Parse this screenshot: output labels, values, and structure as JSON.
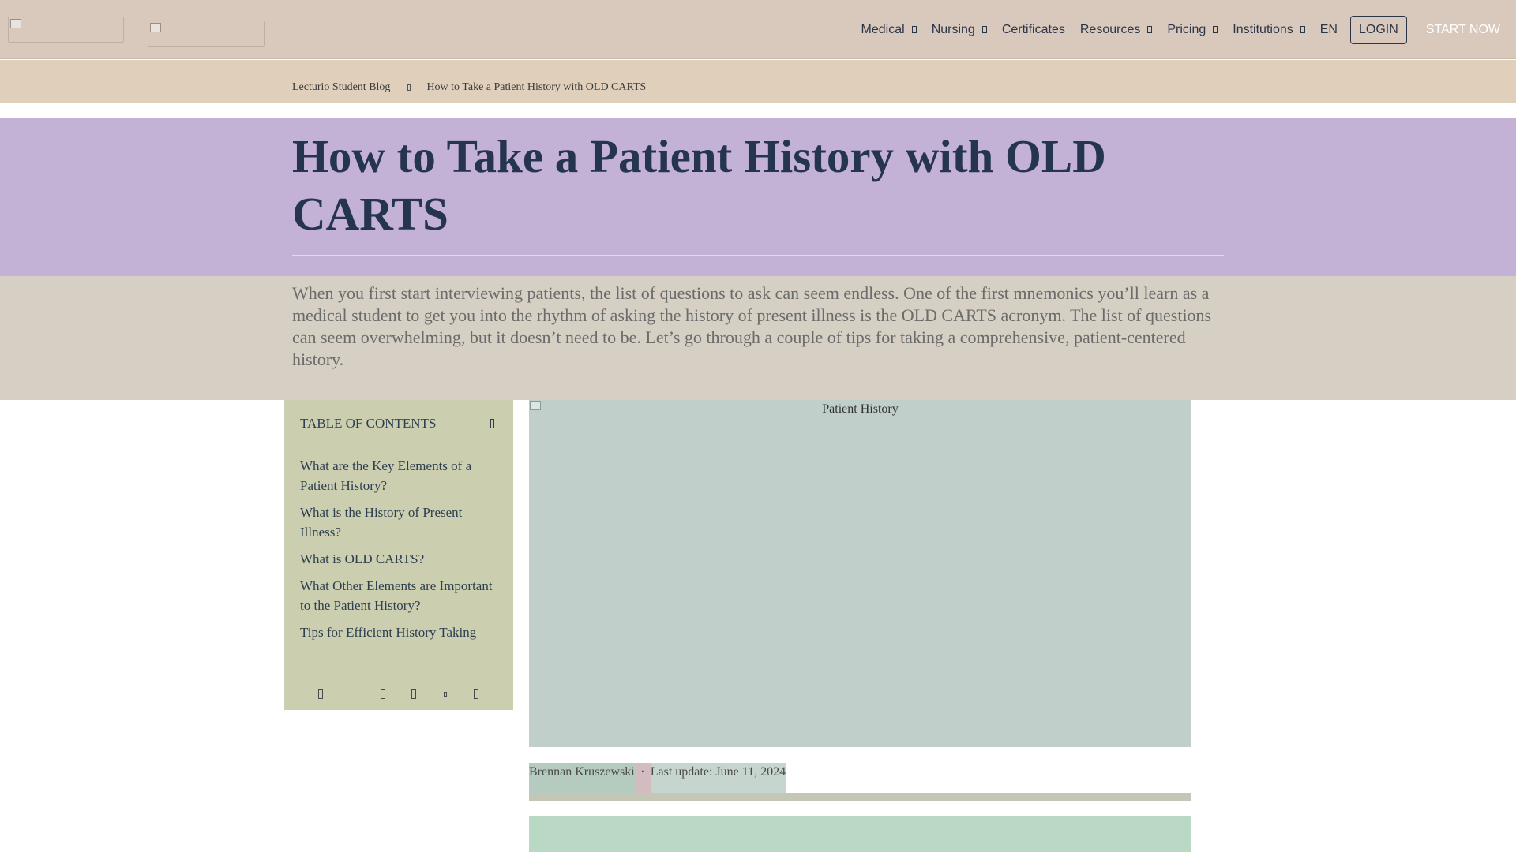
{
  "header": {
    "nav": [
      "Medical",
      "Nursing",
      "Certificates",
      "Resources",
      "Pricing",
      "Institutions"
    ],
    "lang": "EN",
    "login": "LOGIN",
    "start": "START NOW"
  },
  "breadcrumb": {
    "home": "Lecturio Student Blog",
    "current": "How to Take a Patient History with OLD CARTS"
  },
  "article": {
    "title": "How to Take a Patient History with OLD CARTS",
    "intro": "When you first start interviewing patients, the list of questions to ask can seem endless. One of the first mnemonics you’ll learn as a medical student to get you into the rhythm of asking the history of present illness is the OLD CARTS acronym. The list of questions can seem overwhelming, but it doesn’t need to be. Let’s go through a couple of tips for taking a comprehensive, patient-centered history.",
    "image_alt": "Patient History",
    "author": "Brennan Kruszewski",
    "separator": "·",
    "updated": "Last update: June 11, 2024"
  },
  "toc": {
    "heading": "TABLE OF CONTENTS",
    "items": [
      "What are the Key Elements of a Patient History?",
      "What is the History of Present Illness?",
      "What is OLD CARTS?",
      "What Other Elements are Important to the Patient History?",
      "Tips for Efficient History Taking"
    ]
  }
}
